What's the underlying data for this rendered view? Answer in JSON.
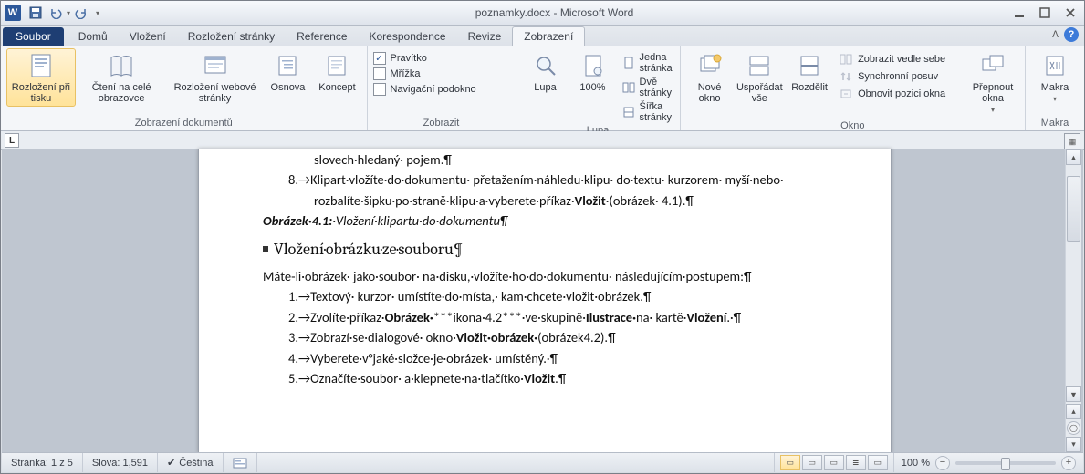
{
  "title": "poznamky.docx  -  Microsoft Word",
  "tabs": {
    "file": "Soubor",
    "items": [
      "Domů",
      "Vložení",
      "Rozložení stránky",
      "Reference",
      "Korespondence",
      "Revize",
      "Zobrazení"
    ],
    "active_index": 6
  },
  "ribbon": {
    "views": {
      "label": "Zobrazení dokumentů",
      "print_layout": "Rozložení při tisku",
      "full_screen": "Čtení na celé obrazovce",
      "web_layout": "Rozložení webové stránky",
      "outline": "Osnova",
      "draft": "Koncept"
    },
    "show": {
      "label": "Zobrazit",
      "ruler": "Pravítko",
      "gridlines": "Mřížka",
      "navpane": "Navigační podokno"
    },
    "zoom": {
      "label": "Lupa",
      "zoom": "Lupa",
      "hundred": "100%",
      "one_page": "Jedna stránka",
      "two_pages": "Dvě stránky",
      "page_width": "Šířka stránky"
    },
    "window": {
      "label": "Okno",
      "new_window": "Nové okno",
      "arrange": "Uspořádat vše",
      "split": "Rozdělit",
      "side_by_side": "Zobrazit vedle sebe",
      "sync_scroll": "Synchronní posuv",
      "reset_pos": "Obnovit pozici okna",
      "switch": "Přepnout okna"
    },
    "macros": {
      "label": "Makra",
      "btn": "Makra"
    }
  },
  "doc": {
    "line0": "slovech·hledaný· pojem.¶",
    "l8a": "8.→Klipart·vložíte·do·dokumentu· přetažením·náhledu·klipu· do·textu· kurzorem· myší·nebo·",
    "l8b": "rozbalíte·šipku·po·straně·klipu·a·vyberete·příkaz·",
    "l8b_bold": "Vložit",
    "l8b_tail": "·(obrázek· 4.1).¶",
    "figcap": "Obrázek·4.1:",
    "figtxt": "·Vložení·klipartu·do·dokumentu¶",
    "h2": "Vložení·obrázku·ze·souboru¶",
    "intro": "Máte-li·obrázek· jako·soubor· na·disku,·vložíte·ho·do·dokumentu· následujícím·postupem:¶",
    "s1": "1.→Textový· kurzor· umístíte·do·místa,· kam·chcete·vložit·obrázek.¶",
    "s2a": "2.→Zvolíte·příkaz·",
    "s2b": "Obrázek·",
    "s2c": "***ikona·4.2***·ve·skupině·",
    "s2d": "Ilustrace·",
    "s2e": "na· kartě·",
    "s2f": "Vložení",
    "s2g": ".·¶",
    "s3a": "3.→Zobrazí·se·dialogové· okno·",
    "s3b": "Vložit·obrázek·",
    "s3c": "(obrázek4.2).¶",
    "s4": "4.→Vyberete·v°jaké·složce·je·obrázek· umístěný.·¶",
    "s5a": "5.→Označíte·soubor· a·klepnete·na·tlačítko·",
    "s5b": "Vložit",
    "s5c": ".¶"
  },
  "status": {
    "page": "Stránka: 1 z 5",
    "words": "Slova: 1,591",
    "lang": "Čeština",
    "zoom": "100 %"
  }
}
